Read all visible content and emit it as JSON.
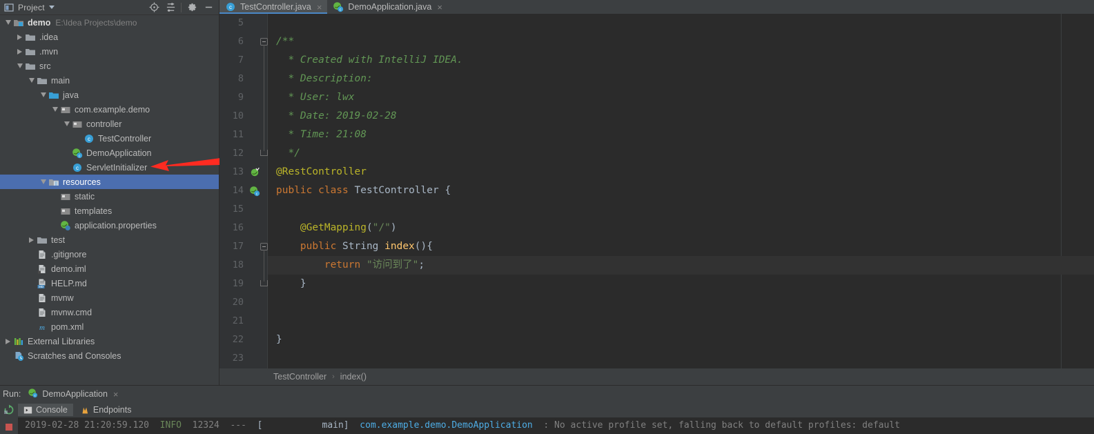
{
  "project_panel": {
    "title": "Project",
    "toolbar_icons": [
      "locate-icon",
      "collapse-all-icon",
      "settings-gear-icon",
      "minimize-icon"
    ],
    "selection_color": "#4B6EAF",
    "tree": [
      {
        "depth": 0,
        "twisty": "down",
        "icon": "module-icon",
        "label": "demo",
        "bold": true,
        "sub": "E:\\Idea Projects\\demo"
      },
      {
        "depth": 1,
        "twisty": "right",
        "icon": "folder-icon",
        "label": ".idea"
      },
      {
        "depth": 1,
        "twisty": "right",
        "icon": "folder-icon",
        "label": ".mvn"
      },
      {
        "depth": 1,
        "twisty": "down",
        "icon": "folder-icon",
        "label": "src"
      },
      {
        "depth": 2,
        "twisty": "down",
        "icon": "folder-icon",
        "label": "main"
      },
      {
        "depth": 3,
        "twisty": "down",
        "icon": "source-root-icon",
        "label": "java"
      },
      {
        "depth": 4,
        "twisty": "down",
        "icon": "package-icon",
        "label": "com.example.demo"
      },
      {
        "depth": 5,
        "twisty": "down",
        "icon": "package-icon",
        "label": "controller"
      },
      {
        "depth": 6,
        "twisty": "none",
        "icon": "java-class-icon",
        "label": "TestController"
      },
      {
        "depth": 5,
        "twisty": "none",
        "icon": "spring-class-icon",
        "label": "DemoApplication"
      },
      {
        "depth": 5,
        "twisty": "none",
        "icon": "java-class-icon",
        "label": "ServletInitializer"
      },
      {
        "depth": 3,
        "twisty": "down",
        "icon": "resource-root-icon",
        "label": "resources",
        "selected": true
      },
      {
        "depth": 4,
        "twisty": "none",
        "icon": "package-icon",
        "label": "static"
      },
      {
        "depth": 4,
        "twisty": "none",
        "icon": "package-icon",
        "label": "templates"
      },
      {
        "depth": 4,
        "twisty": "none",
        "icon": "properties-icon",
        "label": "application.properties"
      },
      {
        "depth": 2,
        "twisty": "right",
        "icon": "folder-icon",
        "label": "test"
      },
      {
        "depth": 2,
        "twisty": "none",
        "icon": "file-icon",
        "label": ".gitignore"
      },
      {
        "depth": 2,
        "twisty": "none",
        "icon": "iml-icon",
        "label": "demo.iml"
      },
      {
        "depth": 2,
        "twisty": "none",
        "icon": "markdown-icon",
        "label": "HELP.md"
      },
      {
        "depth": 2,
        "twisty": "none",
        "icon": "file-icon",
        "label": "mvnw"
      },
      {
        "depth": 2,
        "twisty": "none",
        "icon": "file-icon",
        "label": "mvnw.cmd"
      },
      {
        "depth": 2,
        "twisty": "none",
        "icon": "maven-icon",
        "label": "pom.xml"
      },
      {
        "depth": 0,
        "twisty": "right",
        "icon": "libraries-icon",
        "label": "External Libraries"
      },
      {
        "depth": 0,
        "twisty": "none",
        "icon": "scratches-icon",
        "label": "Scratches and Consoles"
      }
    ]
  },
  "annotation": {
    "type": "red-arrow",
    "color": "#FF2B21",
    "points_at": "ServletInitializer"
  },
  "editor": {
    "tabs": [
      {
        "label": "TestController.java",
        "icon": "java-class-icon",
        "active": true,
        "close": "×"
      },
      {
        "label": "DemoApplication.java",
        "icon": "spring-class-icon",
        "active": false,
        "close": "×"
      }
    ],
    "first_line_number": 5,
    "caret_line": 18,
    "lines": [
      {
        "n": 5,
        "segments": []
      },
      {
        "n": 6,
        "fold": "start",
        "segments": [
          {
            "t": "/**",
            "c": "c-doc"
          }
        ]
      },
      {
        "n": 7,
        "segments": [
          {
            "t": "  * Created with IntelliJ IDEA.",
            "c": "c-doc"
          }
        ]
      },
      {
        "n": 8,
        "segments": [
          {
            "t": "  * Description:",
            "c": "c-doc"
          }
        ]
      },
      {
        "n": 9,
        "segments": [
          {
            "t": "  * User: lwx",
            "c": "c-doc"
          }
        ]
      },
      {
        "n": 10,
        "segments": [
          {
            "t": "  * Date: 2019-02-28",
            "c": "c-doc"
          }
        ]
      },
      {
        "n": 11,
        "segments": [
          {
            "t": "  * Time: 21:08",
            "c": "c-doc"
          }
        ]
      },
      {
        "n": 12,
        "fold": "end",
        "segments": [
          {
            "t": "  */",
            "c": "c-doc"
          }
        ]
      },
      {
        "n": 13,
        "gutter": "spring-bean-icon",
        "segments": [
          {
            "t": "@RestController",
            "c": "c-ann"
          }
        ]
      },
      {
        "n": 14,
        "gutter": "spring-class-icon",
        "segments": [
          {
            "t": "public ",
            "c": "c-kw"
          },
          {
            "t": "class ",
            "c": "c-kw"
          },
          {
            "t": "TestController ",
            "c": "c-cls"
          },
          {
            "t": "{",
            "c": "c-plain"
          }
        ]
      },
      {
        "n": 15,
        "segments": []
      },
      {
        "n": 16,
        "segments": [
          {
            "t": "    @GetMapping",
            "c": "c-ann"
          },
          {
            "t": "(",
            "c": "c-plain"
          },
          {
            "t": "\"/\"",
            "c": "c-str"
          },
          {
            "t": ")",
            "c": "c-plain"
          }
        ]
      },
      {
        "n": 17,
        "fold": "start",
        "segments": [
          {
            "t": "    ",
            "c": "c-plain"
          },
          {
            "t": "public ",
            "c": "c-kw"
          },
          {
            "t": "String ",
            "c": "c-type"
          },
          {
            "t": "index",
            "c": "c-meth"
          },
          {
            "t": "(){",
            "c": "c-plain"
          }
        ]
      },
      {
        "n": 18,
        "caret": true,
        "segments": [
          {
            "t": "        ",
            "c": "c-plain"
          },
          {
            "t": "return ",
            "c": "c-kw"
          },
          {
            "t": "\"访问到了\"",
            "c": "c-str"
          },
          {
            "t": ";",
            "c": "c-plain"
          }
        ]
      },
      {
        "n": 19,
        "fold": "end",
        "segments": [
          {
            "t": "    }",
            "c": "c-plain"
          }
        ]
      },
      {
        "n": 20,
        "segments": []
      },
      {
        "n": 21,
        "segments": []
      },
      {
        "n": 22,
        "segments": [
          {
            "t": "}",
            "c": "c-plain"
          }
        ]
      },
      {
        "n": 23,
        "segments": []
      }
    ],
    "breadcrumb": [
      "TestController",
      "index()"
    ],
    "breadcrumb_separator": "›"
  },
  "run_panel": {
    "run_label": "Run:",
    "configuration": "DemoApplication",
    "configuration_icon": "spring-class-icon",
    "configuration_close": "×",
    "side_icons": [
      "rerun-icon",
      "stop-icon"
    ],
    "tabs": [
      {
        "label": "Console",
        "icon": "console-icon",
        "active": true
      },
      {
        "label": "Endpoints",
        "icon": "endpoints-icon",
        "active": false
      }
    ],
    "console_log": {
      "date": "2019-02-28 21:20:59.120",
      "level": "INFO",
      "pid": "12324",
      "separator": "---",
      "thread": "[           main]",
      "logger": "com.example.demo.DemoApplication",
      "message": ": No active profile set, falling back to default profiles: default"
    }
  }
}
